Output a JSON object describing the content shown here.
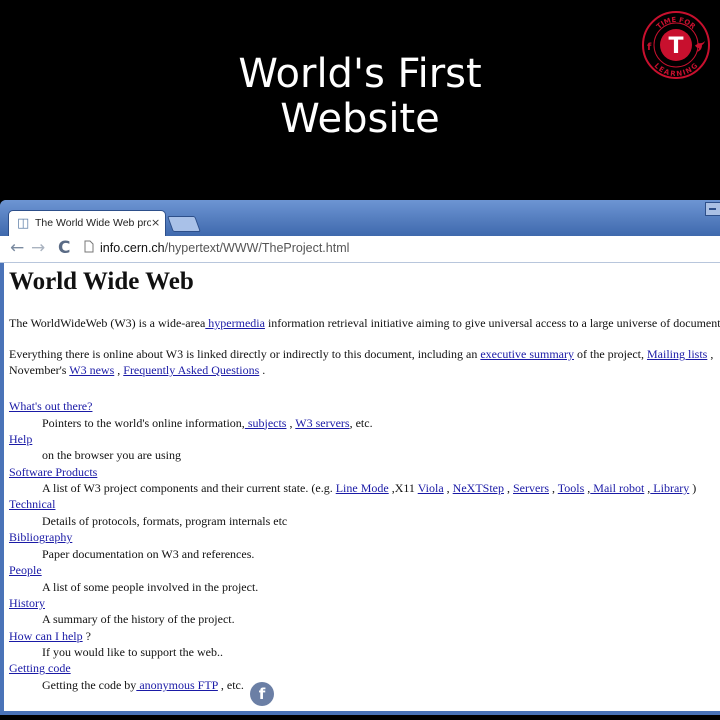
{
  "headline": {
    "line1": "World's First",
    "line2": "Website"
  },
  "logo": {
    "top_text": "TIME FOR",
    "letter": "T",
    "bottom_text": "LEARNING",
    "left_icon": "f",
    "right_icon": "twitter-bird",
    "color": "#c8102e"
  },
  "browser": {
    "tab": {
      "title": "The World Wide Web project",
      "icon": "page-icon",
      "close": "×"
    },
    "toolbar": {
      "back": "←",
      "forward": "→",
      "reload": "C",
      "host": "info.cern.ch",
      "path": "/hypertext/WWW/TheProject.html"
    }
  },
  "page": {
    "title": "World Wide Web",
    "intro": {
      "t1": "The WorldWideWeb (W3) is a wide-area",
      "link1": " hypermedia",
      "t2": " information retrieval initiative aiming to give universal access to a large universe of documents."
    },
    "everything": {
      "t1": "Everything there is online about W3 is linked directly or indirectly to this document, including an ",
      "link1": "executive summary",
      "t2": " of the project, ",
      "link2": "Mailing lists",
      "t3": " , ",
      "t4": "November's ",
      "link3": "W3 news",
      "t5": " , ",
      "link4": "Frequently Asked Questions",
      "t6": " ."
    },
    "items": [
      {
        "term": "What's out there?",
        "def": [
          {
            "t": "Pointers to the world's online information,"
          },
          {
            "l": " subjects"
          },
          {
            "t": " , "
          },
          {
            "l": "W3 servers"
          },
          {
            "t": ", etc."
          }
        ]
      },
      {
        "term": "Help",
        "def": [
          {
            "t": "on the browser you are using"
          }
        ]
      },
      {
        "term": "Software Products",
        "def": [
          {
            "t": "A list of W3 project components and their current state. (e.g. "
          },
          {
            "l": "Line Mode"
          },
          {
            "t": " ,X11 "
          },
          {
            "l": "Viola"
          },
          {
            "t": " , "
          },
          {
            "l": "NeXTStep"
          },
          {
            "t": " , "
          },
          {
            "l": "Servers"
          },
          {
            "t": " , "
          },
          {
            "l": "Tools"
          },
          {
            "t": " ,"
          },
          {
            "l": " Mail robot"
          },
          {
            "t": " ,"
          },
          {
            "l": " Library"
          },
          {
            "t": " )"
          }
        ]
      },
      {
        "term": "Technical",
        "def": [
          {
            "t": "Details of protocols, formats, program internals etc"
          }
        ]
      },
      {
        "term": "Bibliography",
        "def": [
          {
            "t": "Paper documentation on W3 and references."
          }
        ]
      },
      {
        "term": "People",
        "def": [
          {
            "t": "A list of some people involved in the project."
          }
        ]
      },
      {
        "term": "History",
        "def": [
          {
            "t": "A summary of the history of the project."
          }
        ]
      },
      {
        "term": "How can I help",
        "suffix": " ?",
        "def": [
          {
            "t": "If you would like to support the web.."
          }
        ]
      },
      {
        "term": "Getting code",
        "def": [
          {
            "t": "Getting the code by"
          },
          {
            "l": " anonymous FTP"
          },
          {
            "t": " , etc."
          }
        ]
      }
    ]
  },
  "overlay": {
    "facebook_letter": "f"
  }
}
